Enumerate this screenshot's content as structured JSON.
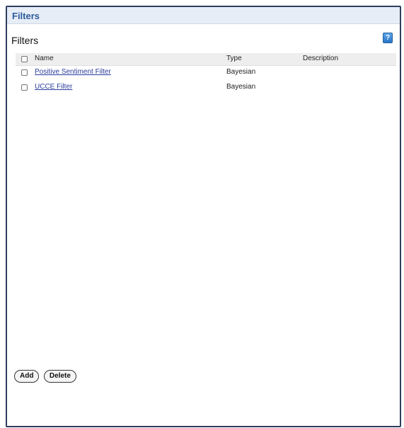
{
  "panel": {
    "title": "Filters"
  },
  "section": {
    "title": "Filters",
    "help_label": "?"
  },
  "table": {
    "columns": [
      "Name",
      "Type",
      "Description"
    ],
    "rows": [
      {
        "name": "Positive Sentiment Filter",
        "type": "Bayesian",
        "description": ""
      },
      {
        "name": "UCCE Filter",
        "type": "Bayesian",
        "description": ""
      }
    ]
  },
  "actions": {
    "add_label": "Add",
    "delete_label": "Delete"
  },
  "colors": {
    "header_text": "#2d5b9b",
    "panel_border": "#2f3e5f",
    "link": "#2a3c9c",
    "help_button": "#2a74c9"
  }
}
